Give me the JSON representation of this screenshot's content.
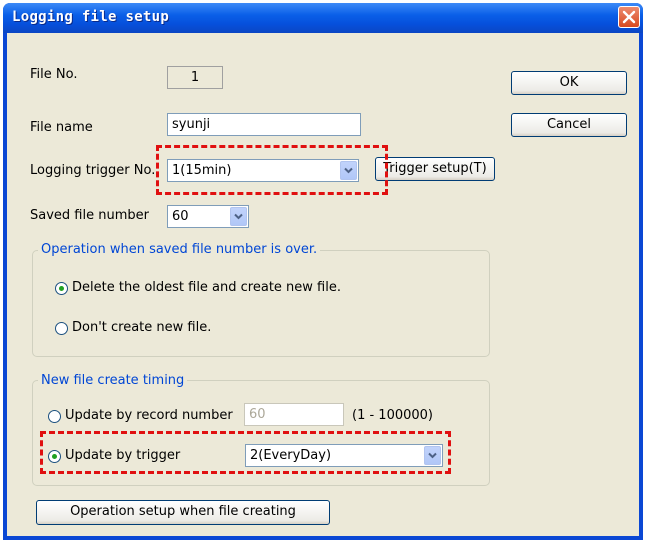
{
  "dialog": {
    "title": "Logging file setup"
  },
  "file_no": {
    "label": "File No.",
    "value": "1"
  },
  "file_name": {
    "label": "File name",
    "value": "syunji"
  },
  "logging_trigger": {
    "label": "Logging trigger No.",
    "value": "1(15min)",
    "setup_button": "Trigger setup(T)"
  },
  "saved_file_number": {
    "label": "Saved file number",
    "value": "60"
  },
  "buttons": {
    "ok": "OK",
    "cancel": "Cancel",
    "operation_setup": "Operation setup when file creating"
  },
  "overflow_group": {
    "title": "Operation when saved file number is over.",
    "options": [
      "Delete the oldest file and create new file.",
      "Don't create new file."
    ],
    "selected": 0
  },
  "timing_group": {
    "title": "New file create timing",
    "record_option": "Update by record number",
    "record_value": "60",
    "record_range": "(1 - 100000)",
    "trigger_option": "Update by trigger",
    "trigger_value": "2(EveryDay)",
    "selected": 1
  },
  "colors": {
    "titlebar": "#0a5fe8",
    "face": "#ece9d8",
    "group_title": "#0046d5",
    "highlight": "#e01010"
  },
  "icons": [
    "close-icon",
    "dropdown-arrow-icon",
    "radio-icon"
  ]
}
